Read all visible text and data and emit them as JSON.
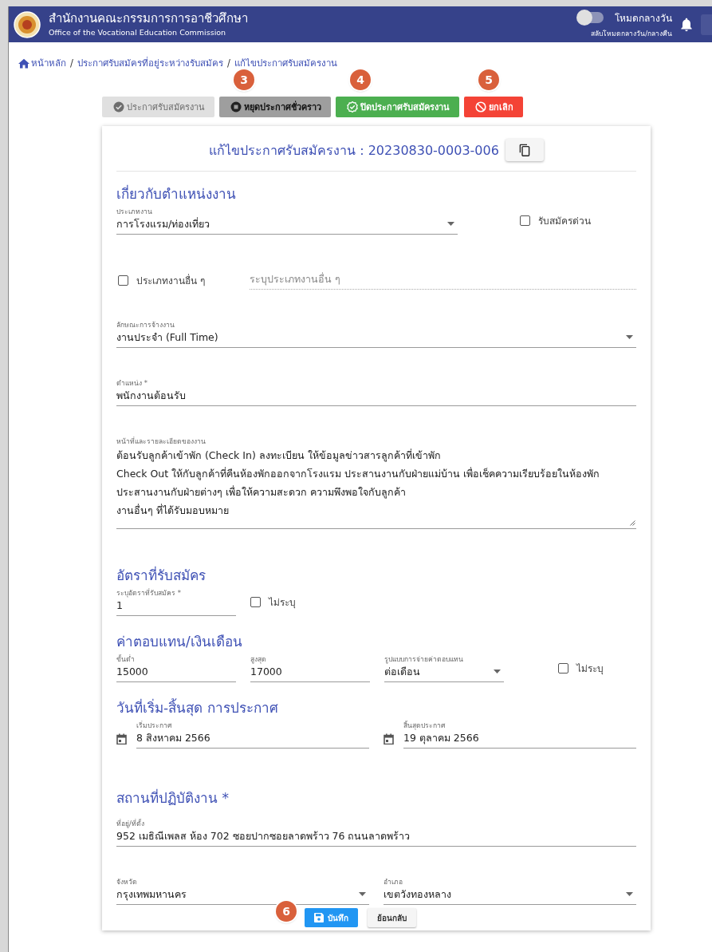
{
  "header": {
    "title": "สำนักงานคณะกรรมการการอาชีวศึกษา",
    "subtitle": "Office of the Vocational Education Commission",
    "theme_toggle": {
      "on": false,
      "label": "โหมดกลางวัน",
      "caption": "สลับโหมดกลางวัน/กลางคืน"
    }
  },
  "breadcrumb": {
    "separator": "/",
    "items": [
      {
        "label": "หน้าหลัก"
      },
      {
        "label": "ประกาศรับสมัครที่อยู่ระหว่างรับสมัคร"
      },
      {
        "label": "แก้ไขประกาศรับสมัครงาน"
      }
    ]
  },
  "actions": [
    {
      "kind": "publish",
      "label": "ประกาศรับสมัครงาน",
      "disabled": true
    },
    {
      "kind": "pause",
      "label": "หยุดประกาศชั่วคราว",
      "disabled": false,
      "badge": "3"
    },
    {
      "kind": "close",
      "label": "ปิดประกาศรับสมัครงาน",
      "disabled": false,
      "badge": "4"
    },
    {
      "kind": "cancel",
      "label": "ยกเลิก",
      "disabled": false,
      "badge": "5"
    }
  ],
  "form": {
    "title": "แก้ไขประกาศรับสมัครงาน : 20230830-0003-006",
    "sections": [
      {
        "heading": "เกี่ยวกับตำแหน่งงาน",
        "rows": [
          [
            {
              "kind": "select",
              "label": "ประเภทงาน",
              "value": "การโรงแรม/ท่องเที่ยว"
            },
            {
              "kind": "checkbox",
              "label": "รับสมัครด่วน",
              "checked": false
            }
          ],
          [
            {
              "kind": "checkbox",
              "label": "ประเภทงานอื่น ๆ",
              "checked": false
            },
            {
              "kind": "text",
              "placeholder": "ระบุประเภทงานอื่น ๆ",
              "disabled": true
            }
          ],
          [
            {
              "kind": "select",
              "label": "ลักษณะการจ้างงาน",
              "value": "งานประจำ (Full Time)"
            }
          ],
          [
            {
              "kind": "text",
              "label": "ตำแหน่ง *",
              "value": "พนักงานต้อนรับ",
              "disabled": false
            }
          ],
          [
            {
              "kind": "textarea",
              "label": "หน้าที่และรายละเอียดของงาน",
              "lines": [
                "ต้อนรับลูกค้าเข้าพัก (Check In) ลงทะเบียน ให้ข้อมูลข่าวสารลูกค้าที่เข้าพัก",
                "Check Out ให้กับลูกค้าที่คืนห้องพักออกจากโรงแรม ประสานงานกับฝ่ายแม่บ้าน เพื่อเช็คความเรียบร้อยในห้องพัก",
                "ประสานงานกับฝ่ายต่างๆ เพื่อให้ความสะดวก ความพึงพอใจกับลูกค้า",
                "งานอื่นๆ ที่ได้รับมอบหมาย"
              ]
            }
          ]
        ]
      },
      {
        "heading": "อัตราที่รับสมัคร",
        "rows": [
          [
            {
              "kind": "text",
              "label": "ระบุอัตราที่รับสมัคร *",
              "value": "1",
              "disabled": false
            },
            {
              "kind": "checkbox",
              "label": "ไม่ระบุ",
              "checked": false
            }
          ]
        ]
      },
      {
        "heading": "ค่าตอบแทน/เงินเดือน",
        "rows": [
          [
            {
              "kind": "text",
              "label": "ขั้นต่ำ",
              "value": "15000",
              "disabled": false
            },
            {
              "kind": "text",
              "label": "สูงสุด",
              "value": "17000",
              "disabled": false
            },
            {
              "kind": "select",
              "label": "รูปแบบการจ่ายค่าตอบแทน",
              "value": "ต่อเดือน"
            },
            {
              "kind": "checkbox",
              "label": "ไม่ระบุ",
              "checked": false
            }
          ]
        ]
      },
      {
        "heading": "วันที่เริ่ม-สิ้นสุด การประกาศ",
        "rows": [
          [
            {
              "kind": "date",
              "label": "เริ่มประกาศ",
              "value": "8 สิงหาคม 2566"
            },
            {
              "kind": "date",
              "label": "สิ้นสุดประกาศ",
              "value": "19 ตุลาคม 2566"
            }
          ]
        ]
      },
      {
        "heading": "สถานที่ปฏิบัติงาน *",
        "rows": [
          [
            {
              "kind": "text",
              "label": "ที่อยู่/ที่ตั้ง",
              "value": "952 เมธิณีเพลส ห้อง 702 ซอยปากซอยลาดพร้าว 76 ถนนลาดพร้าว",
              "disabled": false
            }
          ],
          [
            {
              "kind": "select",
              "label": "จังหวัด",
              "value": "กรุงเทพมหานคร"
            },
            {
              "kind": "select",
              "label": "อำเภอ",
              "value": "เขตวังทองหลาง"
            }
          ]
        ]
      }
    ]
  },
  "footer_buttons": [
    {
      "kind": "save",
      "label": "บันทึก",
      "badge": "6"
    },
    {
      "kind": "back",
      "label": "ย้อนกลับ"
    }
  ]
}
